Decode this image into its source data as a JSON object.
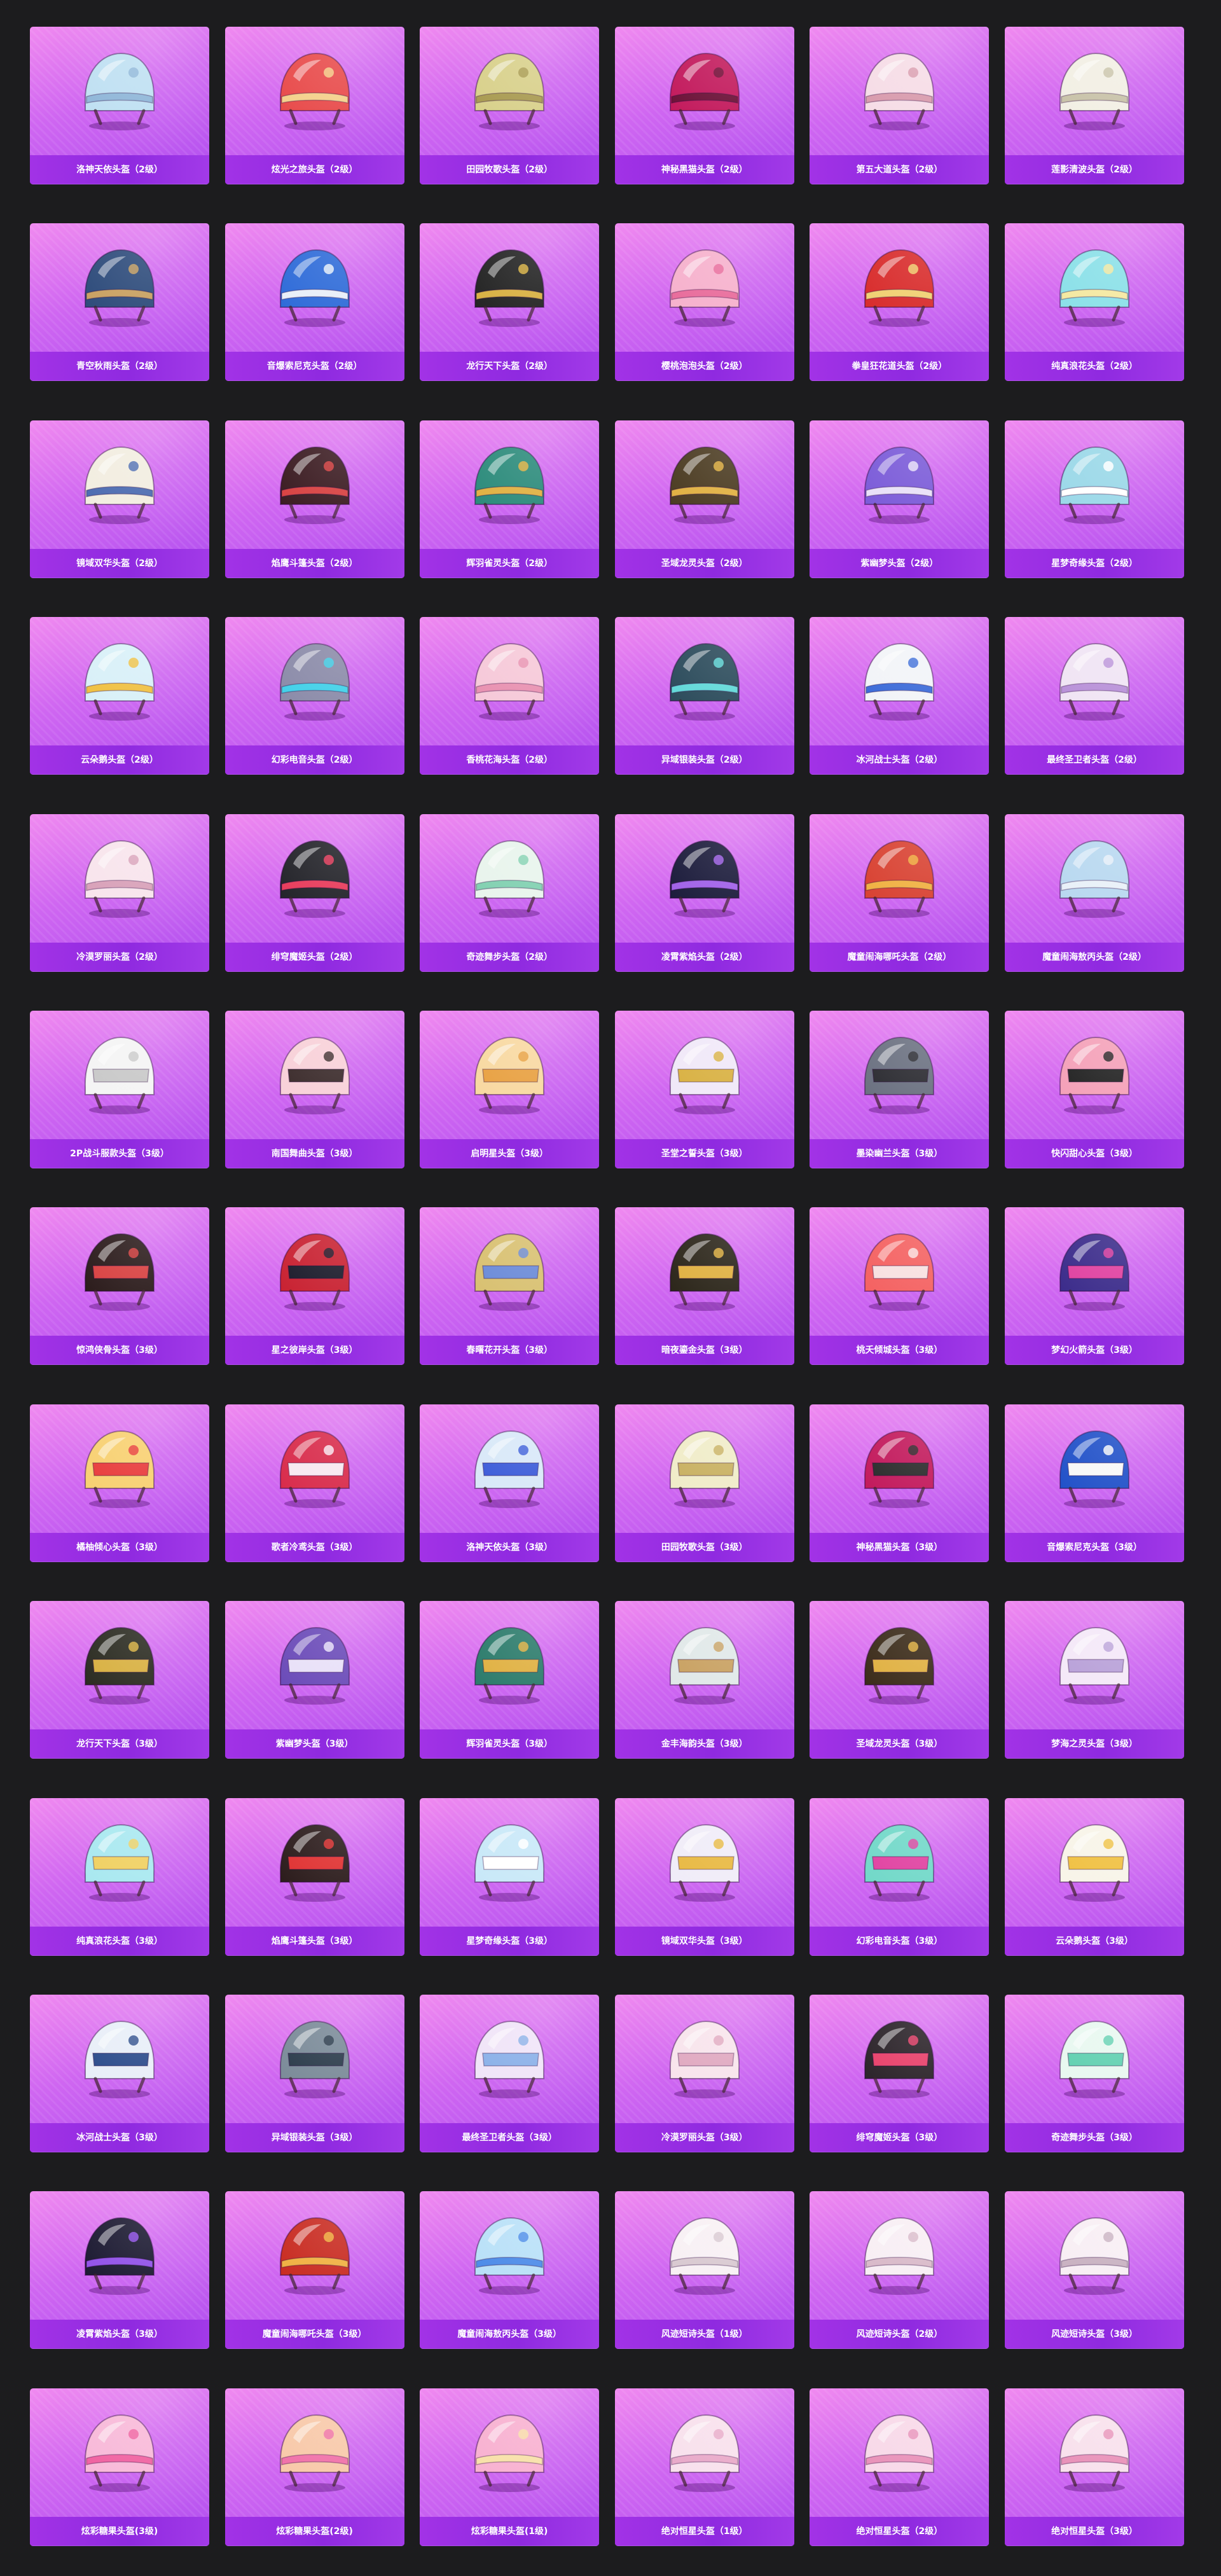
{
  "gallery": {
    "items": [
      {
        "name": "洛神天依头盔（2级）",
        "icon": "helmet-icon",
        "color": "#bfe0f2",
        "accent": "#8fb6d8"
      },
      {
        "name": "炫光之旅头盔（2级）",
        "icon": "helmet-icon",
        "color": "#e84a4a",
        "accent": "#f4d08a"
      },
      {
        "name": "田园牧歌头盔（2级）",
        "icon": "helmet-icon",
        "color": "#d8d08a",
        "accent": "#a89a50"
      },
      {
        "name": "神秘黑猫头盔（2级）",
        "icon": "helmet-icon",
        "color": "#c2185b",
        "accent": "#6a0f35"
      },
      {
        "name": "第五大道头盔（2级）",
        "icon": "helmet-icon",
        "color": "#f6dce6",
        "accent": "#d89aac"
      },
      {
        "name": "莲影清波头盔（2级）",
        "icon": "helmet-icon",
        "color": "#f2efe4",
        "accent": "#c8c2a8"
      },
      {
        "name": "青空秋雨头盔（2级）",
        "icon": "helmet-icon",
        "color": "#2c4a7a",
        "accent": "#c8a060"
      },
      {
        "name": "音爆索尼克头盔（2级）",
        "icon": "helmet-icon",
        "color": "#2d6ad8",
        "accent": "#e8eef8"
      },
      {
        "name": "龙行天下头盔（2级）",
        "icon": "helmet-icon",
        "color": "#222222",
        "accent": "#d8b040"
      },
      {
        "name": "樱桃泡泡头盔（2级）",
        "icon": "helmet-icon",
        "color": "#f6b0cc",
        "accent": "#e86a9a"
      },
      {
        "name": "拳皇狂花道头盔（2级）",
        "icon": "helmet-icon",
        "color": "#d82a2a",
        "accent": "#f0d070"
      },
      {
        "name": "纯真浪花头盔（2级）",
        "icon": "helmet-icon",
        "color": "#8ae0e8",
        "accent": "#f4e8a0"
      },
      {
        "name": "镜域双华头盔（2级）",
        "icon": "helmet-icon",
        "color": "#f2ede0",
        "accent": "#4a6ab0"
      },
      {
        "name": "焰鹰斗篷头盔（2级）",
        "icon": "helmet-icon",
        "color": "#3a1a20",
        "accent": "#d84040"
      },
      {
        "name": "辉羽雀灵头盔（2级）",
        "icon": "helmet-icon",
        "color": "#2a8a7a",
        "accent": "#e0b040"
      },
      {
        "name": "圣域龙灵头盔（2级）",
        "icon": "helmet-icon",
        "color": "#4a3a20",
        "accent": "#e0b040"
      },
      {
        "name": "紫幽梦头盔（2级）",
        "icon": "helmet-icon",
        "color": "#7a5ad8",
        "accent": "#e8e0f8"
      },
      {
        "name": "星梦奇缘头盔（2级）",
        "icon": "helmet-icon",
        "color": "#9ad8e8",
        "accent": "#ffffff"
      },
      {
        "name": "云朵鹅头盔（2级）",
        "icon": "helmet-icon",
        "color": "#d8f0f8",
        "accent": "#f0c040"
      },
      {
        "name": "幻彩电音头盔（2级）",
        "icon": "helmet-icon",
        "color": "#8a8aa8",
        "accent": "#40d0e8"
      },
      {
        "name": "香桃花海头盔（2级）",
        "icon": "helmet-icon",
        "color": "#f6c8d8",
        "accent": "#e890b0"
      },
      {
        "name": "异域银装头盔（2级）",
        "icon": "helmet-icon",
        "color": "#2a4a5a",
        "accent": "#60d8d8"
      },
      {
        "name": "冰河战士头盔（2级）",
        "icon": "helmet-icon",
        "color": "#f2f4f8",
        "accent": "#3a6ad8"
      },
      {
        "name": "最终圣卫者头盔（2级）",
        "icon": "helmet-icon",
        "color": "#f0e4f4",
        "accent": "#b890d8"
      },
      {
        "name": "冷漠罗丽头盔（2级）",
        "icon": "helmet-icon",
        "color": "#f8e4ec",
        "accent": "#d8a0b8"
      },
      {
        "name": "绯穹魔姬头盔（2级）",
        "icon": "helmet-icon",
        "color": "#222228",
        "accent": "#e83a5a"
      },
      {
        "name": "奇迹舞步头盔（2级）",
        "icon": "helmet-icon",
        "color": "#e8f4ec",
        "accent": "#80d0b0"
      },
      {
        "name": "凌霄紫焰头盔（2级）",
        "icon": "helmet-icon",
        "color": "#1a1a3a",
        "accent": "#a060e8"
      },
      {
        "name": "魔童闹海哪吒头盔（2级）",
        "icon": "helmet-icon",
        "color": "#d84030",
        "accent": "#f0b040"
      },
      {
        "name": "魔童闹海敖丙头盔（2级）",
        "icon": "helmet-icon",
        "color": "#b8d8f0",
        "accent": "#e8f0f8"
      },
      {
        "name": "2P战斗服款头盔（3级）",
        "icon": "helmet-icon",
        "color": "#f4f4f4",
        "accent": "#c8c8c8"
      },
      {
        "name": "南国舞曲头盔（3级）",
        "icon": "helmet-icon",
        "color": "#f8d0d8",
        "accent": "#3a2a2a"
      },
      {
        "name": "启明星头盔（3级）",
        "icon": "helmet-icon",
        "color": "#f8d8a0",
        "accent": "#e8a040"
      },
      {
        "name": "圣堂之誓头盔（3级）",
        "icon": "helmet-icon",
        "color": "#f0e8f8",
        "accent": "#d8b040"
      },
      {
        "name": "墨染幽兰头盔（3级）",
        "icon": "helmet-icon",
        "color": "#6a7080",
        "accent": "#2a2a30"
      },
      {
        "name": "快闪甜心头盔（3级）",
        "icon": "helmet-icon",
        "color": "#f4a0b8",
        "accent": "#222222"
      },
      {
        "name": "惊鸿侠骨头盔（3级）",
        "icon": "helmet-icon",
        "color": "#2a1a1a",
        "accent": "#d84040"
      },
      {
        "name": "星之彼岸头盔（3级）",
        "icon": "helmet-icon",
        "color": "#c82030",
        "accent": "#1a1a2a"
      },
      {
        "name": "春曙花开头盔（3级）",
        "icon": "helmet-icon",
        "color": "#d8c070",
        "accent": "#6a8ad8"
      },
      {
        "name": "暗夜鎏金头盔（3级）",
        "icon": "helmet-icon",
        "color": "#2a2418",
        "accent": "#e0b040"
      },
      {
        "name": "桃夭倾城头盔（3级）",
        "icon": "helmet-icon",
        "color": "#f46060",
        "accent": "#f8e0e0"
      },
      {
        "name": "梦幻火箭头盔（3级）",
        "icon": "helmet-icon",
        "color": "#3a2a8a",
        "accent": "#e040a0"
      },
      {
        "name": "橘柚倾心头盔（3级）",
        "icon": "helmet-icon",
        "color": "#f8d070",
        "accent": "#e83a3a"
      },
      {
        "name": "歌者冷鸢头盔（3级）",
        "icon": "helmet-icon",
        "color": "#d82a4a",
        "accent": "#f8e8f0"
      },
      {
        "name": "洛神天依头盔（3级）",
        "icon": "helmet-icon",
        "color": "#d8e8f8",
        "accent": "#3a5ad8"
      },
      {
        "name": "田园牧歌头盔（3级）",
        "icon": "helmet-icon",
        "color": "#f0ecc8",
        "accent": "#c8b060"
      },
      {
        "name": "神秘黑猫头盔（3级）",
        "icon": "helmet-icon",
        "color": "#c2185b",
        "accent": "#2a2a2a"
      },
      {
        "name": "音爆索尼克头盔（3级）",
        "icon": "helmet-icon",
        "color": "#2050c8",
        "accent": "#f8f8f8"
      },
      {
        "name": "龙行天下头盔（3级）",
        "icon": "helmet-icon",
        "color": "#2a2a20",
        "accent": "#d8b040"
      },
      {
        "name": "紫幽梦头盔（3级）",
        "icon": "helmet-icon",
        "color": "#6a4ab8",
        "accent": "#e8e0f8"
      },
      {
        "name": "辉羽雀灵头盔（3级）",
        "icon": "helmet-icon",
        "color": "#2a7a6a",
        "accent": "#e0b040"
      },
      {
        "name": "金丰海韵头盔（3级）",
        "icon": "helmet-icon",
        "color": "#e0e8e8",
        "accent": "#c8a060"
      },
      {
        "name": "圣域龙灵头盔（3级）",
        "icon": "helmet-icon",
        "color": "#3a2a18",
        "accent": "#e0b040"
      },
      {
        "name": "梦海之灵头盔（3级）",
        "icon": "helmet-icon",
        "color": "#f4e8f8",
        "accent": "#b8a0d8"
      },
      {
        "name": "纯真浪花头盔（3级）",
        "icon": "helmet-icon",
        "color": "#a8e8f0",
        "accent": "#f0d060"
      },
      {
        "name": "焰鹰斗篷头盔（3级）",
        "icon": "helmet-icon",
        "color": "#2a1a1a",
        "accent": "#e03030"
      },
      {
        "name": "星梦奇缘头盔（3级）",
        "icon": "helmet-icon",
        "color": "#c8e8f8",
        "accent": "#ffffff"
      },
      {
        "name": "镜域双华头盔（3级）",
        "icon": "helmet-icon",
        "color": "#f0ecf8",
        "accent": "#e8b840"
      },
      {
        "name": "幻彩电音头盔（3级）",
        "icon": "helmet-icon",
        "color": "#70d8c8",
        "accent": "#e040a0"
      },
      {
        "name": "云朵鹅头盔（3级）",
        "icon": "helmet-icon",
        "color": "#f8f4e8",
        "accent": "#f0c040"
      },
      {
        "name": "冰河战士头盔（3级）",
        "icon": "helmet-icon",
        "color": "#e8eef8",
        "accent": "#2a4a8a"
      },
      {
        "name": "异域银装头盔（3级）",
        "icon": "helmet-icon",
        "color": "#7a8a98",
        "accent": "#2a3a4a"
      },
      {
        "name": "最终圣卫者头盔（3级）",
        "icon": "helmet-icon",
        "color": "#f0e4f8",
        "accent": "#8ab0e8"
      },
      {
        "name": "冷漠罗丽头盔（3级）",
        "icon": "helmet-icon",
        "color": "#f8e4ec",
        "accent": "#e0a8c0"
      },
      {
        "name": "绯穹魔姬头盔（3级）",
        "icon": "helmet-icon",
        "color": "#2a2228",
        "accent": "#e8406a"
      },
      {
        "name": "奇迹舞步头盔（3级）",
        "icon": "helmet-icon",
        "color": "#e8f8f0",
        "accent": "#60d0b0"
      },
      {
        "name": "凌霄紫焰头盔（3级）",
        "icon": "helmet-icon",
        "color": "#1a1830",
        "accent": "#9050e8"
      },
      {
        "name": "魔童闹海哪吒头盔（3级）",
        "icon": "helmet-icon",
        "color": "#c82a20",
        "accent": "#f0b040"
      },
      {
        "name": "魔童闹海敖丙头盔（3级）",
        "icon": "helmet-icon",
        "color": "#b8e0f8",
        "accent": "#4a8ae8"
      },
      {
        "name": "风迹短诗头盔（1级）",
        "icon": "helmet-icon",
        "color": "#f8f0f4",
        "accent": "#d8c8d0"
      },
      {
        "name": "风迹短诗头盔（2级）",
        "icon": "helmet-icon",
        "color": "#f8eef4",
        "accent": "#d8b8c8"
      },
      {
        "name": "风迹短诗头盔（3级）",
        "icon": "helmet-icon",
        "color": "#f8eef4",
        "accent": "#c8b0c0"
      },
      {
        "name": "炫彩糖果头盔(3级)",
        "icon": "helmet-icon",
        "color": "#f8b8d8",
        "accent": "#f060a0"
      },
      {
        "name": "炫彩糖果头盔(2级)",
        "icon": "helmet-icon",
        "color": "#f8c8a8",
        "accent": "#f070a8"
      },
      {
        "name": "炫彩糖果头盔(1级)",
        "icon": "helmet-icon",
        "color": "#f8b0d0",
        "accent": "#f8e0a8"
      },
      {
        "name": "绝对恒星头盔（1级）",
        "icon": "helmet-icon",
        "color": "#f8e0ec",
        "accent": "#e8a8c8"
      },
      {
        "name": "绝对恒星头盔（2级）",
        "icon": "helmet-icon",
        "color": "#f8d8e8",
        "accent": "#e890b8"
      },
      {
        "name": "绝对恒星头盔（3级）",
        "icon": "helmet-icon",
        "color": "#f8e0ec",
        "accent": "#e890b8"
      }
    ]
  }
}
